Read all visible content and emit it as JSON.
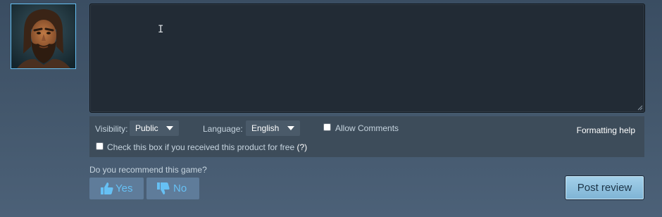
{
  "review": {
    "text_value": ""
  },
  "options": {
    "visibility_label": "Visibility:",
    "visibility_value": "Public",
    "language_label": "Language:",
    "language_value": "English",
    "allow_comments_label": "Allow Comments",
    "allow_comments_checked": false,
    "free_product_label": "Check this box if you received this product for free",
    "free_product_help": "(?)",
    "free_product_checked": false,
    "formatting_help": "Formatting help"
  },
  "recommend": {
    "question": "Do you recommend this game?",
    "yes_label": "Yes",
    "no_label": "No",
    "yes_icon": "thumbs-up-icon",
    "no_icon": "thumbs-down-icon"
  },
  "post_button": "Post review",
  "colors": {
    "accent": "#66c0f4",
    "vote_button_bg": "#5f7c9a",
    "post_button_bg": "#8fc3e2",
    "textarea_bg": "#222b35",
    "options_bar_bg": "#3d4c5a"
  }
}
